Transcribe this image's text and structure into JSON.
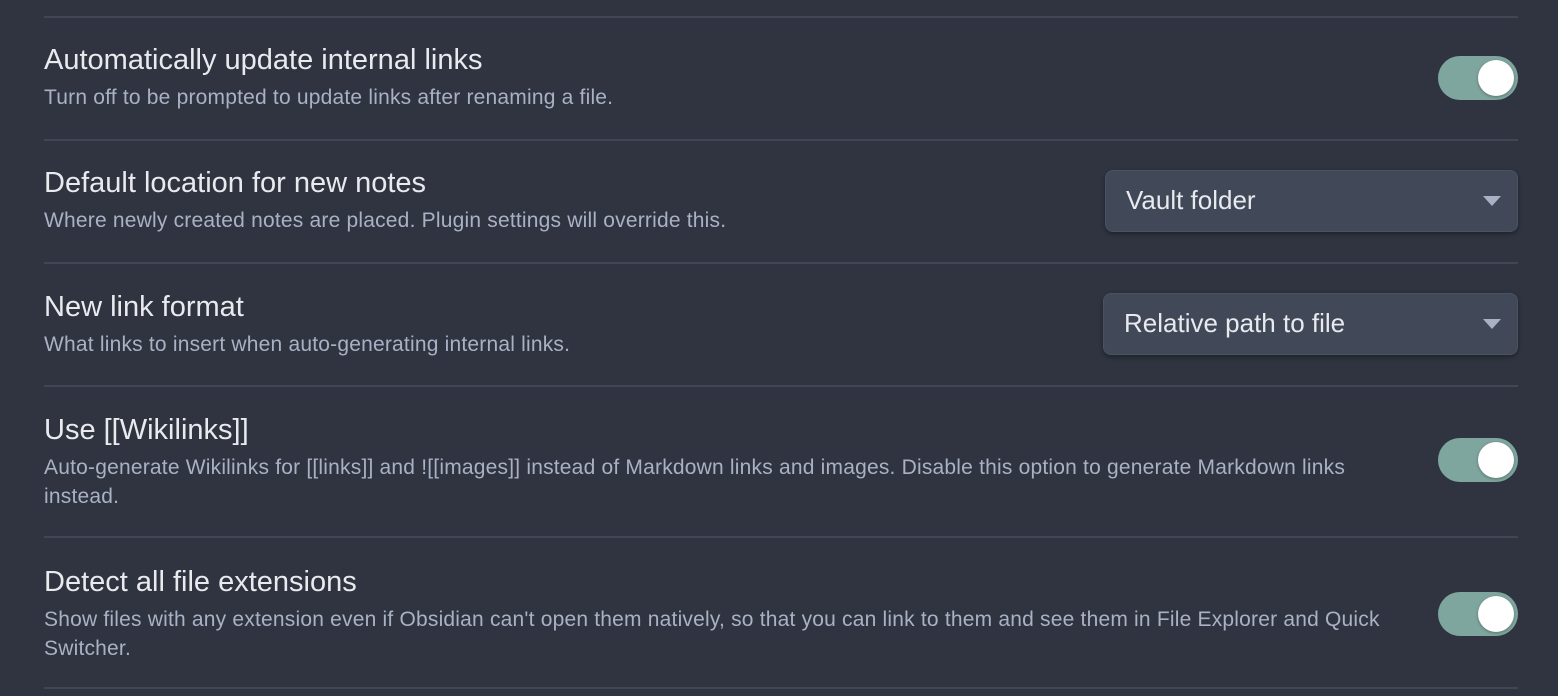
{
  "settings": [
    {
      "title": "Automatically update internal links",
      "description": "Turn off to be prompted to update links after renaming a file.",
      "control": "toggle",
      "enabled": true
    },
    {
      "title": "Default location for new notes",
      "description": "Where newly created notes are placed. Plugin settings will override this.",
      "control": "dropdown",
      "value": "Vault folder"
    },
    {
      "title": "New link format",
      "description": "What links to insert when auto-generating internal links.",
      "control": "dropdown",
      "value": "Relative path to file"
    },
    {
      "title": "Use [[Wikilinks]]",
      "description": "Auto-generate Wikilinks for [[links]] and ![[images]] instead of Markdown links and images. Disable this option to generate Markdown links instead.",
      "control": "toggle",
      "enabled": true
    },
    {
      "title": "Detect all file extensions",
      "description": "Show files with any extension even if Obsidian can't open them natively, so that you can link to them and see them in File Explorer and Quick Switcher.",
      "control": "toggle",
      "enabled": true
    }
  ],
  "colors": {
    "background": "#2f3440",
    "toggle_on": "#7fa69e",
    "divider": "#404654",
    "dropdown_bg": "#414858"
  }
}
